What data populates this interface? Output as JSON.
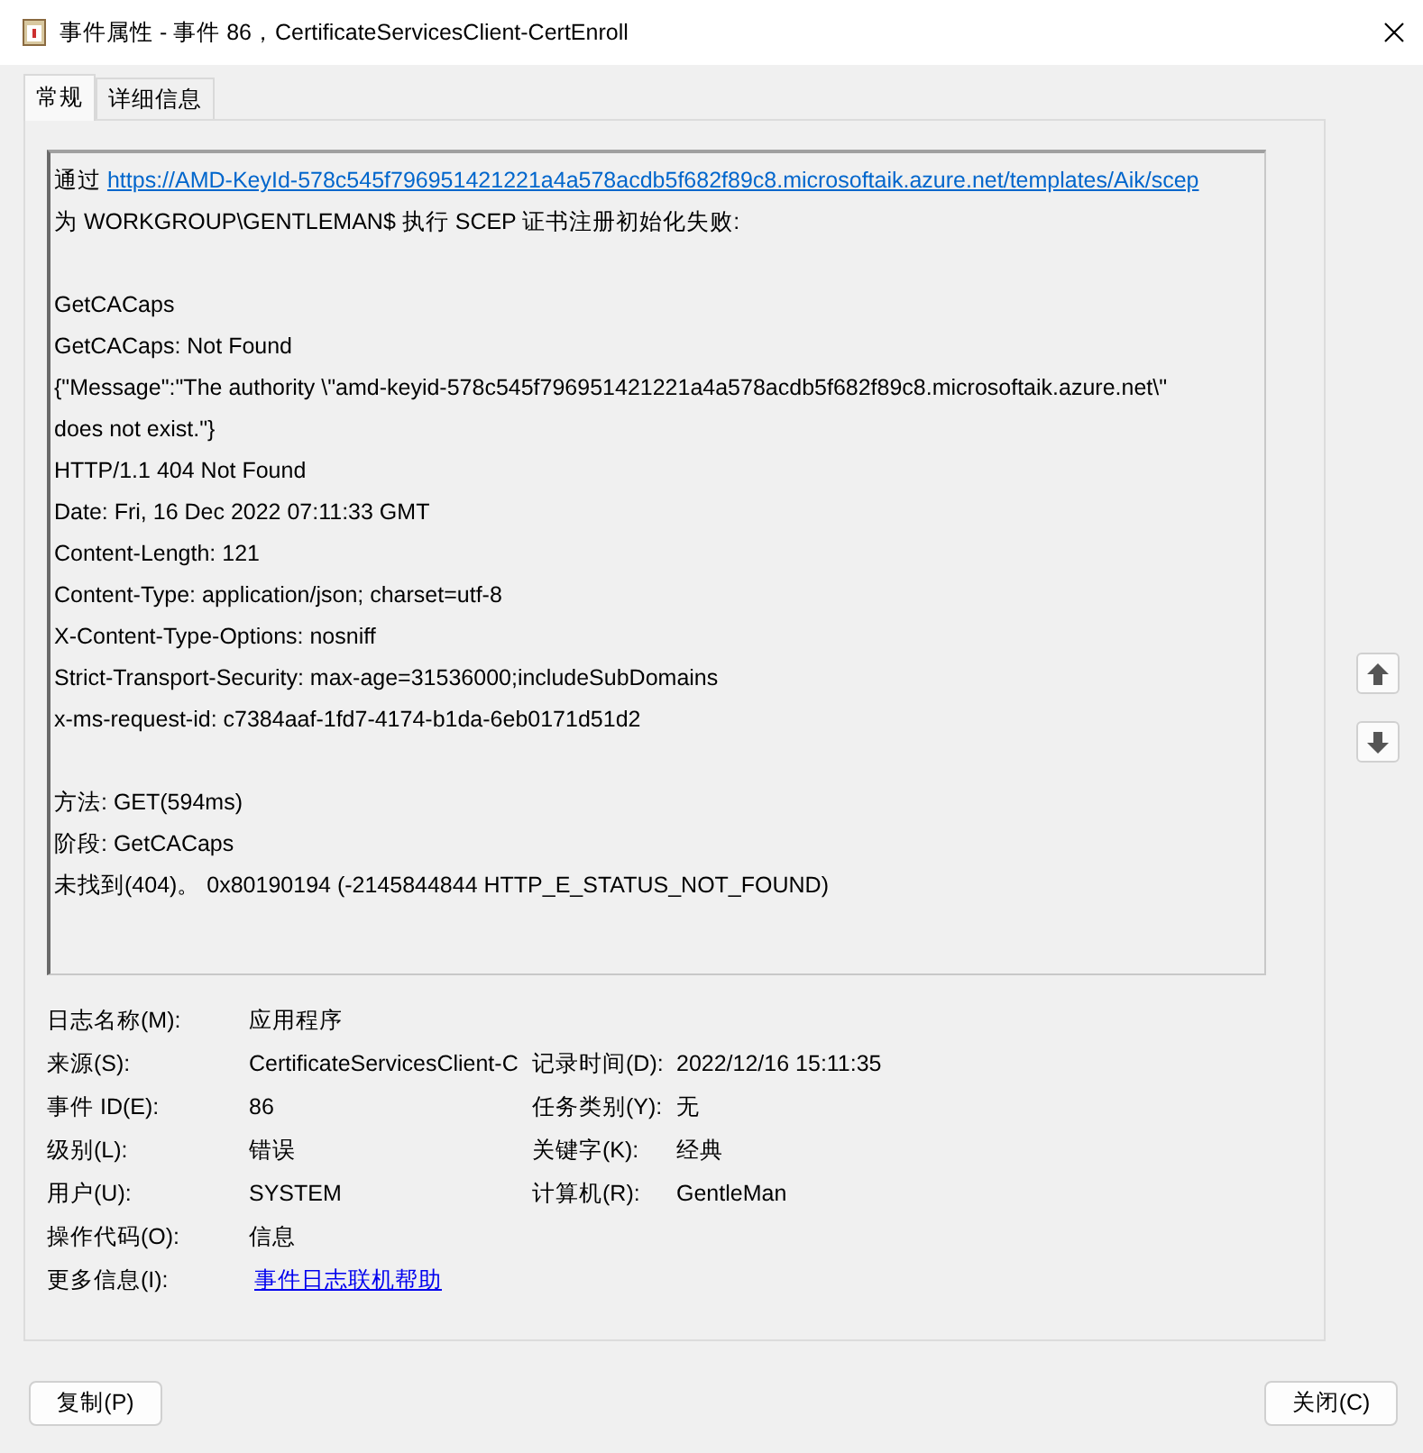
{
  "window": {
    "title": "事件属性 - 事件 86，CertificateServicesClient-CertEnroll"
  },
  "tabs": [
    {
      "label": "常规",
      "selected": true
    },
    {
      "label": "详细信息",
      "selected": false
    }
  ],
  "description": {
    "blocks": [
      [
        {
          "kind": "link",
          "prefix": "通过",
          "link": "https://AMD-KeyId-578c545f796951421221a4a578acdb5f682f89c8.microsoftaik.azure.net/templates/Aik/scep"
        },
        {
          "kind": "text",
          "text": "为 WORKGROUP\\GENTLEMAN$ 执行 SCEP 证书注册初始化失败:"
        }
      ],
      [
        {
          "kind": "text",
          "text": "GetCACaps"
        },
        {
          "kind": "text",
          "text": "GetCACaps: Not Found"
        },
        {
          "kind": "text",
          "text": "{\"Message\":\"The authority \\\"amd-keyid-578c545f796951421221a4a578acdb5f682f89c8.microsoftaik.azure.net\\\""
        },
        {
          "kind": "text",
          "text": "does not exist.\"}"
        },
        {
          "kind": "text",
          "text": "HTTP/1.1 404 Not Found"
        },
        {
          "kind": "text",
          "text": "Date: Fri, 16 Dec 2022 07:11:33 GMT"
        },
        {
          "kind": "text",
          "text": "Content-Length: 121"
        },
        {
          "kind": "text",
          "text": "Content-Type: application/json; charset=utf-8"
        },
        {
          "kind": "text",
          "text": "X-Content-Type-Options: nosniff"
        },
        {
          "kind": "text",
          "text": "Strict-Transport-Security: max-age=31536000;includeSubDomains"
        },
        {
          "kind": "text",
          "text": "x-ms-request-id: c7384aaf-1fd7-4174-b1da-6eb0171d51d2"
        }
      ],
      [
        {
          "kind": "text",
          "text": "方法: GET(594ms)"
        },
        {
          "kind": "text",
          "text": "阶段: GetCACaps"
        },
        {
          "kind": "text",
          "text": "未找到(404)。 0x80190194 (-2145844844 HTTP_E_STATUS_NOT_FOUND)"
        }
      ]
    ]
  },
  "fields": [
    {
      "left": {
        "label": "日志名称(M):",
        "value": "应用程序",
        "kind": "text"
      }
    },
    {
      "left": {
        "label": "来源(S):",
        "value": "CertificateServicesClient-C",
        "kind": "text"
      },
      "right": {
        "label": "记录时间(D):",
        "value": "2022/12/16 15:11:35"
      }
    },
    {
      "left": {
        "label": "事件 ID(E):",
        "value": "86",
        "kind": "text"
      },
      "right": {
        "label": "任务类别(Y):",
        "value": "无"
      }
    },
    {
      "left": {
        "label": "级别(L):",
        "value": "错误",
        "kind": "text"
      },
      "right": {
        "label": "关键字(K):",
        "value": "经典"
      }
    },
    {
      "left": {
        "label": "用户(U):",
        "value": "SYSTEM",
        "kind": "text"
      },
      "right": {
        "label": "计算机(R):",
        "value": "GentleMan"
      }
    },
    {
      "left": {
        "label": "操作代码(O):",
        "value": "信息",
        "kind": "text"
      }
    },
    {
      "left": {
        "label": "更多信息(I):",
        "value": "事件日志联机帮助",
        "kind": "link"
      }
    }
  ],
  "buttons": {
    "left": "复制(P)",
    "right": "关闭(C)"
  }
}
